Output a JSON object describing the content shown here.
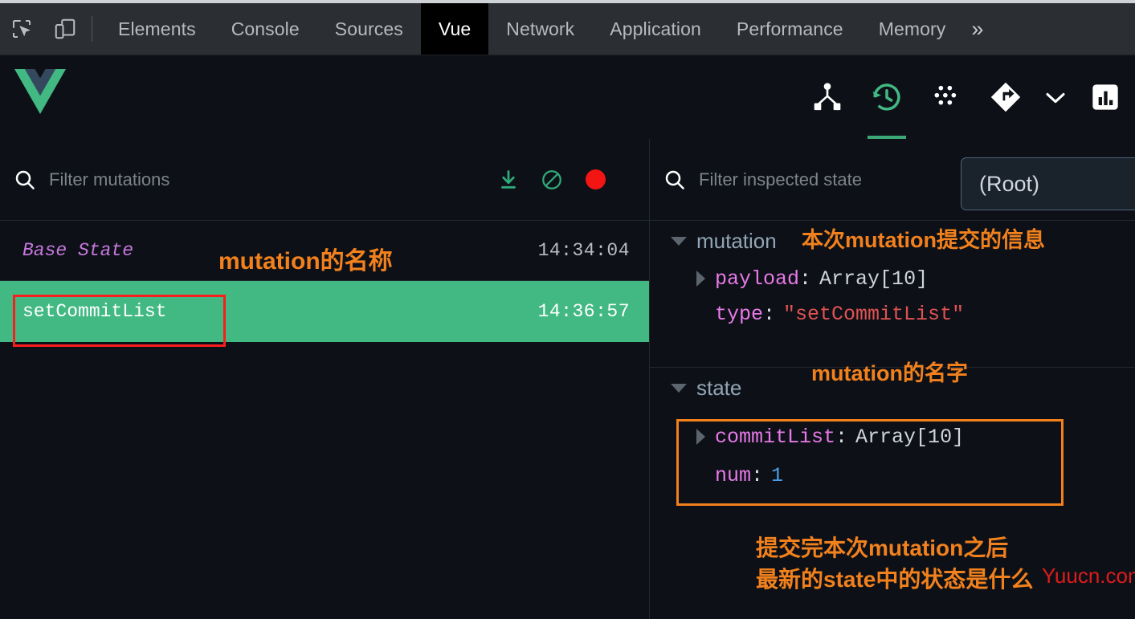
{
  "devtools": {
    "toolbar_icons": [
      {
        "name": "inspect-element-icon",
        "label": "Inspect element"
      },
      {
        "name": "device-toolbar-icon",
        "label": "Toggle device toolbar"
      }
    ],
    "tabs": [
      {
        "label": "Elements",
        "active": false
      },
      {
        "label": "Console",
        "active": false
      },
      {
        "label": "Sources",
        "active": false
      },
      {
        "label": "Vue",
        "active": true
      },
      {
        "label": "Network",
        "active": false
      },
      {
        "label": "Application",
        "active": false
      },
      {
        "label": "Performance",
        "active": false
      },
      {
        "label": "Memory",
        "active": false
      }
    ],
    "more_tabs_label": "»"
  },
  "vue_toolbar": {
    "logo_name": "vue-logo",
    "buttons": [
      {
        "name": "components-tree-icon",
        "label": "Components",
        "active": false
      },
      {
        "name": "vuex-history-icon",
        "label": "Vuex",
        "active": true
      },
      {
        "name": "events-icon",
        "label": "Events",
        "active": false
      },
      {
        "name": "routing-icon",
        "label": "Routing",
        "active": false
      },
      {
        "name": "chevron-down-icon",
        "label": "More",
        "active": false
      },
      {
        "name": "performance-icon",
        "label": "Performance",
        "active": false
      }
    ],
    "accent_color": "#3ba776"
  },
  "left_panel": {
    "search_icon": "search-icon",
    "filter": {
      "placeholder": "Filter mutations",
      "value": ""
    },
    "actions": [
      {
        "name": "export-state-button",
        "icon": "download-icon",
        "color": "#3eb489"
      },
      {
        "name": "clear-mutations-button",
        "icon": "no-entry-icon",
        "color": "#3eb489"
      },
      {
        "name": "record-toggle-button",
        "icon": "record-dot-icon",
        "color": "#f31414"
      }
    ],
    "mutations": [
      {
        "name": "Base State",
        "time": "14:34:04",
        "selected": false,
        "base": true
      },
      {
        "name": "setCommitList",
        "time": "14:36:57",
        "selected": true,
        "base": false
      }
    ]
  },
  "right_panel": {
    "search_icon": "search-icon",
    "filter": {
      "placeholder": "Filter inspected state",
      "value": ""
    },
    "root_selector": {
      "label": "(Root)"
    },
    "sections": [
      {
        "title": "mutation",
        "rows": [
          {
            "expandable": true,
            "key": "payload",
            "value": "Array[10]",
            "value_type": "object"
          },
          {
            "expandable": false,
            "key": "type",
            "value": "\"setCommitList\"",
            "value_type": "string"
          }
        ]
      },
      {
        "title": "state",
        "rows": [
          {
            "expandable": true,
            "key": "commitList",
            "value": "Array[10]",
            "value_type": "object"
          },
          {
            "expandable": false,
            "key": "num",
            "value": "1",
            "value_type": "number"
          }
        ]
      }
    ]
  },
  "annotations": {
    "mutation_name_left": "mutation的名称",
    "mutation_info_right": "本次mutation提交的信息",
    "mutation_name_right": "mutation的名字",
    "state_after_line1": "提交完本次mutation之后",
    "state_after_line2": "最新的state中的状态是什么",
    "highlight_color_red": "#fb1d1d",
    "highlight_color_orange": "#f2811d",
    "watermark": "Yuucn.com"
  }
}
